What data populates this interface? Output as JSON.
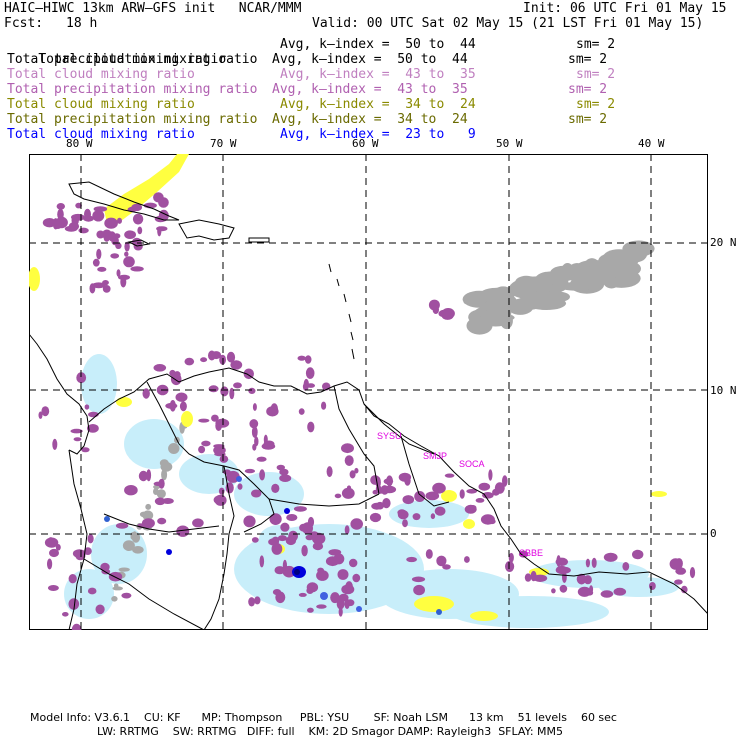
{
  "header": {
    "title": "HAIC–HIWC 13km ARW–GFS init   NCAR/MMM",
    "init": "Init: 06 UTC Fri 01 May 15",
    "fcst_label": "Fcst:",
    "fcst_value": "18 h",
    "valid": "Valid: 00 UTC Sat 02 May 15 (21 LST Fri 01 May 15)"
  },
  "legend": [
    {
      "field": "Total cloud mixing ratio",
      "range": "Avg, k–index =  50 to  44",
      "sm": "sm= 2",
      "color": "#000000"
    },
    {
      "field": "Total precipitation mixing ratio",
      "range": "Avg, k–index =  50 to  44",
      "sm": "sm= 2",
      "color": "#000000"
    },
    {
      "field": "Total cloud mixing ratio",
      "range": "Avg, k–index =  43 to  35",
      "sm": "sm= 2",
      "color": "#c080c0"
    },
    {
      "field": "Total precipitation mixing ratio",
      "range": "Avg, k–index =  43 to  35",
      "sm": "sm= 2",
      "color": "#b060b0"
    },
    {
      "field": "Total cloud mixing ratio",
      "range": "Avg, k–index =  34 to  24",
      "sm": "sm= 2",
      "color": "#8a8a00"
    },
    {
      "field": "Total precipitation mixing ratio",
      "range": "Avg, k–index =  34 to  24",
      "sm": "sm= 2",
      "color": "#6a6a00"
    },
    {
      "field": "Total cloud mixing ratio",
      "range": "Avg, k–index =  23 to   9",
      "sm": "",
      "color": "#0000ff"
    }
  ],
  "map": {
    "lon_labels": [
      "80 W",
      "70 W",
      "60 W",
      "50 W",
      "40 W"
    ],
    "lat_labels": [
      "20 N",
      "10 N",
      "0"
    ],
    "station_labels": [
      "SYSU",
      "SMJP",
      "SOCA",
      "SBBE"
    ],
    "station_color": "#e000e0",
    "colors": {
      "cloud_gray": "#a8a8a8",
      "purple": "#a050a0",
      "yellow": "#ffff40",
      "light_blue": "#c8eefa",
      "blue": "#0000dd"
    }
  },
  "footer": {
    "line1": "Model Info: V3.6.1    CU: KF      MP: Thompson     PBL: YSU       SF: Noah LSM      13 km    51 levels    60 sec",
    "line2": "LW: RRTMG    SW: RRTMG   DIFF: full    KM: 2D Smagor DAMP: Rayleigh3  SFLAY: MM5"
  }
}
